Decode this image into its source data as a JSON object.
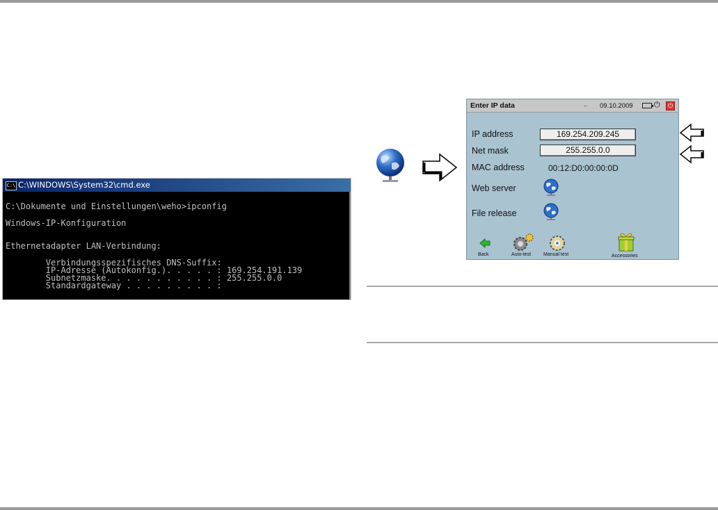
{
  "cmd": {
    "title": "C:\\WINDOWS\\System32\\cmd.exe",
    "icon_text": "C:\\",
    "lines": [
      "C:\\Dokumente und Einstellungen\\weho>ipconfig",
      "Windows-IP-Konfiguration",
      "Ethernetadapter LAN-Verbindung:",
      "        Verbindungsspezifisches DNS-Suffix:",
      "        IP-Adresse (Autokonfig.). . . . . : 169.254.191.139",
      "        Subnetzmaske. . . . . . . . . . . : 255.255.0.0",
      "        Standardgateway . . . . . . . . . :"
    ]
  },
  "device": {
    "title": "Enter IP data",
    "dots": "..",
    "date": "09.10.2009",
    "ip_label": "IP address",
    "ip_value": "169.254.209.245",
    "mask_label": "Net mask",
    "mask_value": "255.255.0.0",
    "mac_label": "MAC address",
    "mac_value": "00:12:D0:00:00:0D",
    "web_label": "Web server",
    "file_label": "File release",
    "bottom": {
      "back": "Back",
      "auto": "Auto-test",
      "manual": "Manual test",
      "accessories": "Accessories"
    }
  },
  "colors": {
    "screen_bg": "#a9c3d1",
    "cmd_bg": "#000000",
    "cmd_title": "#0a246a"
  },
  "icons": [
    "network-globe-icon",
    "arrow-right-icon",
    "arrow-left-icon",
    "back-arrow-icon",
    "gear-icon",
    "gift-icon",
    "battery-icon",
    "plug-icon",
    "power-icon"
  ]
}
